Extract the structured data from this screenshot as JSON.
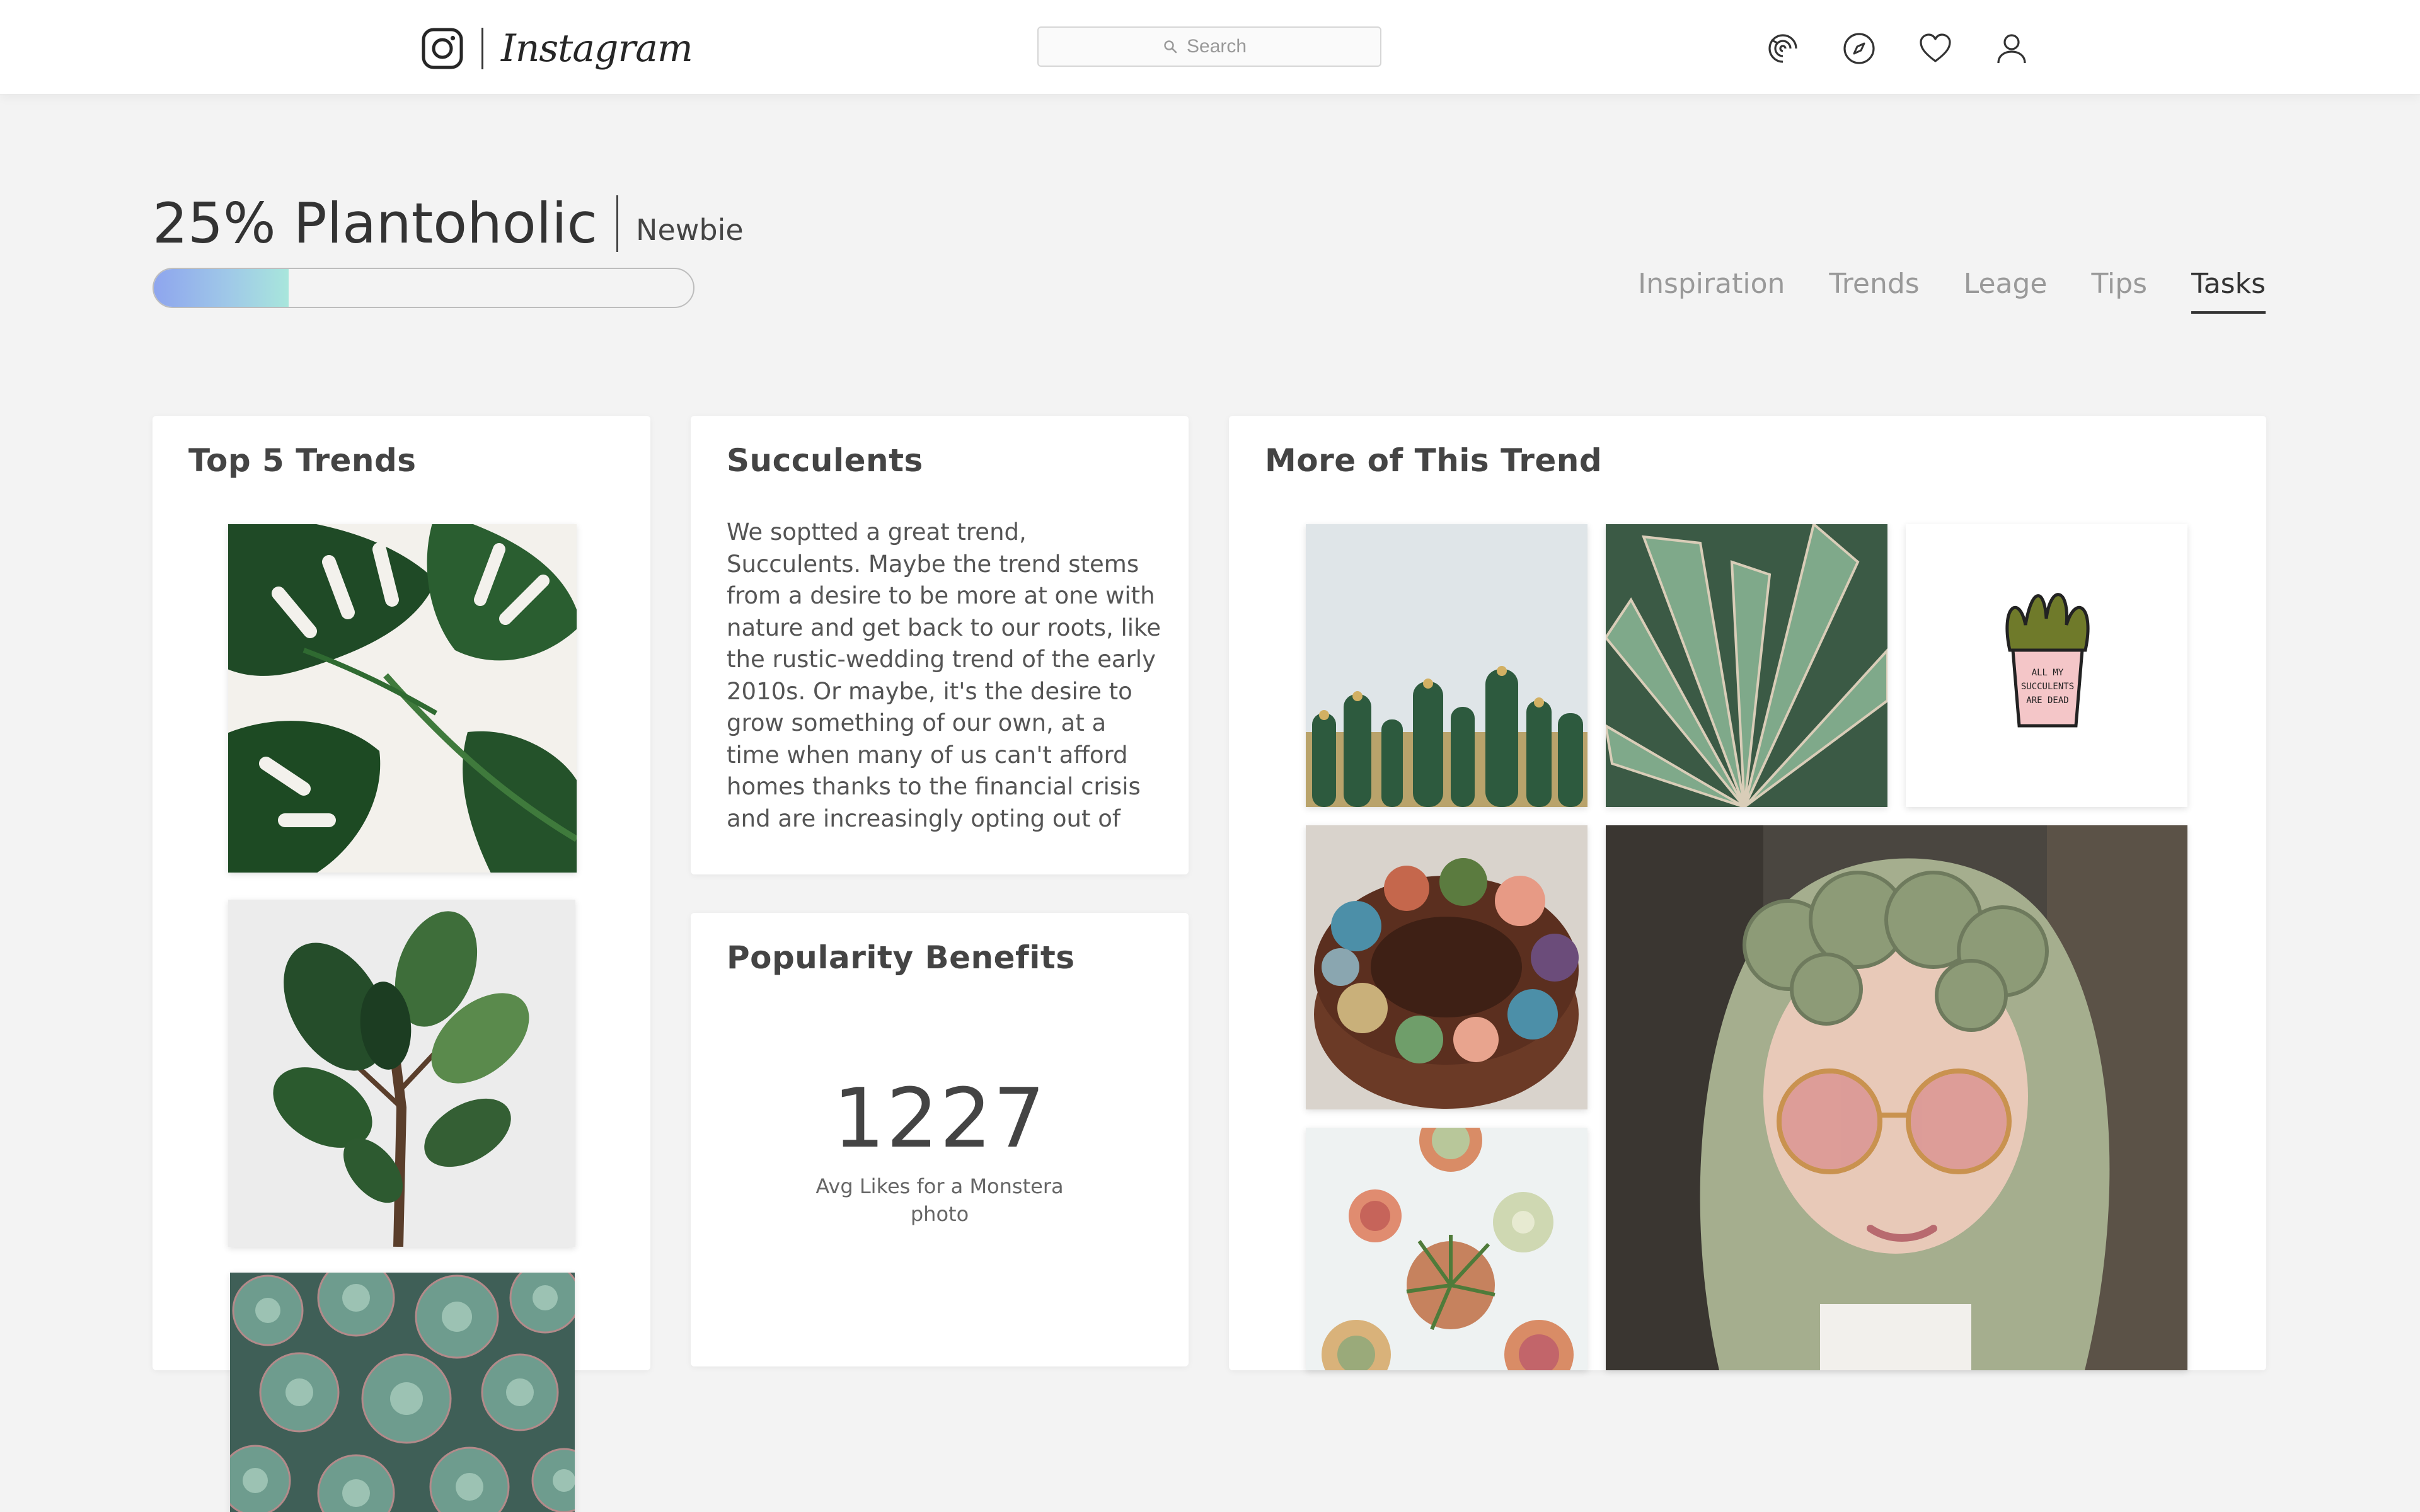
{
  "header": {
    "app_name": "Instagram",
    "search": {
      "placeholder": "Search"
    },
    "nav_icons": [
      "activity-icon",
      "compass-icon",
      "heart-icon",
      "profile-icon"
    ]
  },
  "level": {
    "title": "25% Plantoholic",
    "badge": "Newbie",
    "progress_percent": 25
  },
  "tabs": [
    {
      "label": "Inspiration",
      "active": false
    },
    {
      "label": "Trends",
      "active": false
    },
    {
      "label": "Leage",
      "active": false
    },
    {
      "label": "Tips",
      "active": false
    },
    {
      "label": "Tasks",
      "active": true
    }
  ],
  "top_trends": {
    "title": "Top 5 Trends"
  },
  "succulents": {
    "title": "Succulents",
    "body": "We soptted a great trend, Succulents. Maybe the trend stems from a desire to be more at one with nature and get back to our roots, like the rustic-wedding trend of the early 2010s. Or maybe, it's the desire to grow something of our own, at a time when many of us can't afford homes thanks to the financial crisis and are increasingly opting out of having kids."
  },
  "popularity": {
    "title": "Popularity Benefits",
    "value": "1227",
    "caption": "Avg Likes for a Monstera photo"
  },
  "more_trend": {
    "title": "More of This Trend",
    "pin_text": "ALL MY SUCCULENTS ARE DEAD"
  },
  "colors": {
    "progress_start": "#8ea5ee",
    "progress_end": "#a8e6dc",
    "background": "#f3f3f3"
  }
}
